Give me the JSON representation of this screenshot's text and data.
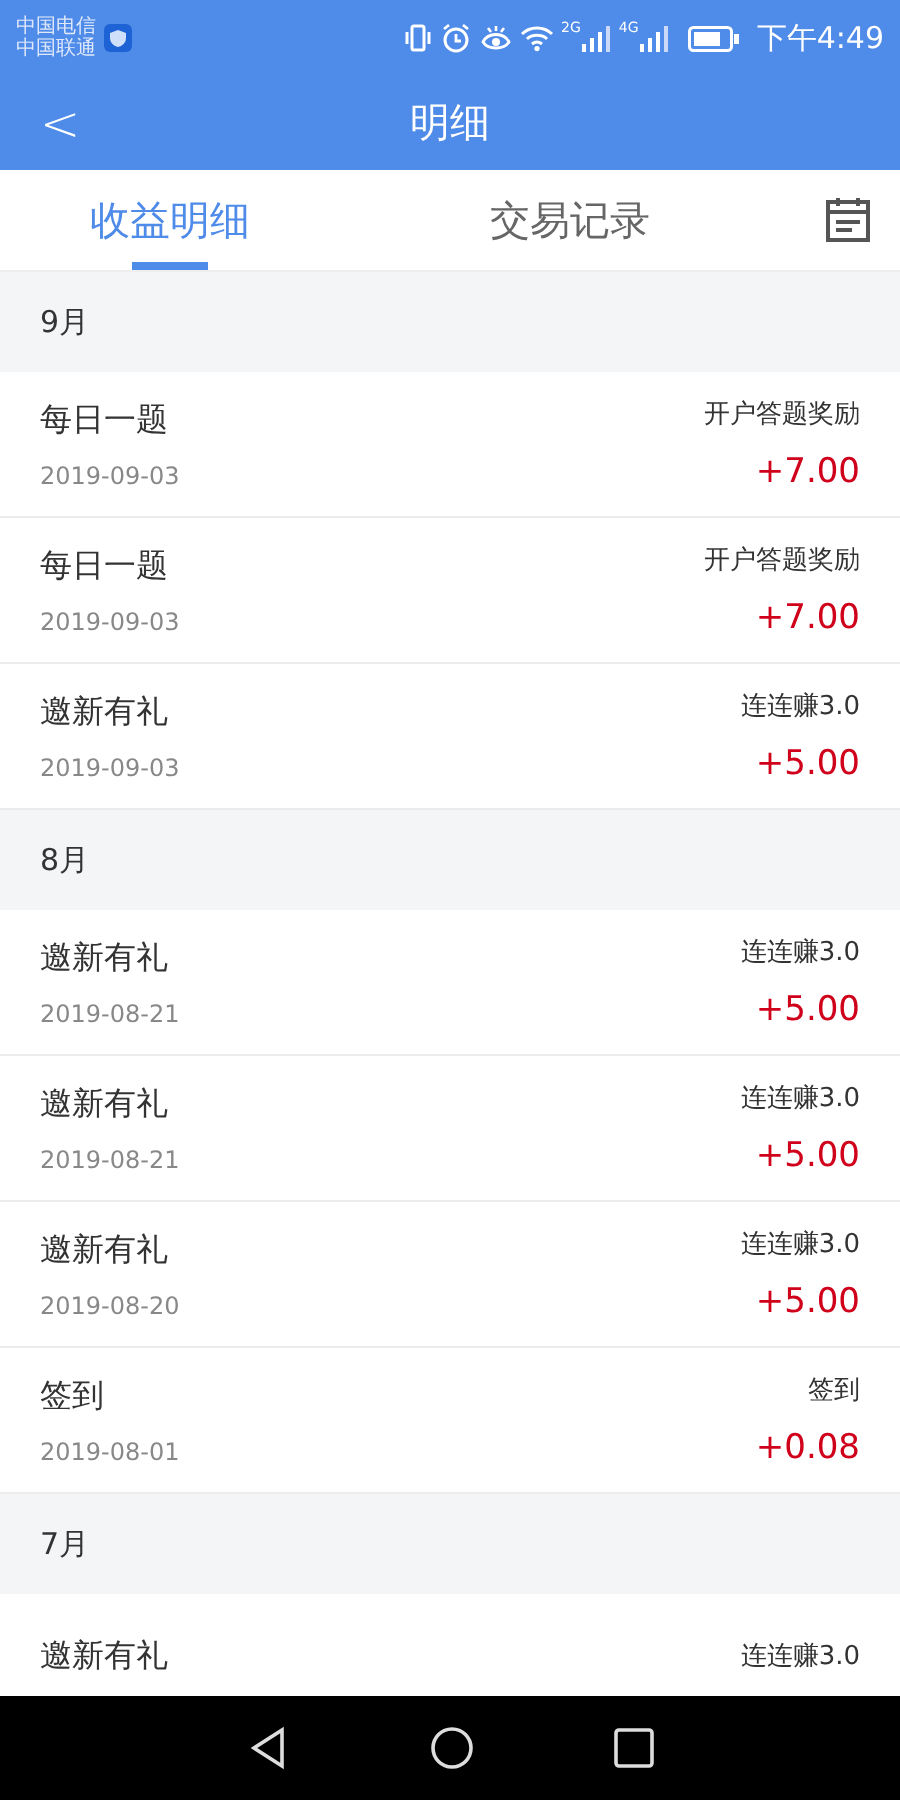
{
  "status_bar": {
    "carriers": [
      "中国电信",
      "中国联通"
    ],
    "networks": [
      "2G",
      "4G"
    ],
    "time": "下午4:49"
  },
  "header": {
    "back": "<",
    "title": "明细"
  },
  "tabs": [
    {
      "label": "收益明细",
      "selected": true
    },
    {
      "label": "交易记录",
      "selected": false
    }
  ],
  "sections": [
    {
      "month": "9月",
      "records": [
        {
          "title": "每日一题",
          "date": "2019-09-03",
          "source": "开户答题奖励",
          "amount": "+7.00"
        },
        {
          "title": "每日一题",
          "date": "2019-09-03",
          "source": "开户答题奖励",
          "amount": "+7.00"
        },
        {
          "title": "邀新有礼",
          "date": "2019-09-03",
          "source": "连连赚3.0",
          "amount": "+5.00"
        }
      ]
    },
    {
      "month": "8月",
      "records": [
        {
          "title": "邀新有礼",
          "date": "2019-08-21",
          "source": "连连赚3.0",
          "amount": "+5.00"
        },
        {
          "title": "邀新有礼",
          "date": "2019-08-21",
          "source": "连连赚3.0",
          "amount": "+5.00"
        },
        {
          "title": "邀新有礼",
          "date": "2019-08-20",
          "source": "连连赚3.0",
          "amount": "+5.00"
        },
        {
          "title": "签到",
          "date": "2019-08-01",
          "source": "签到",
          "amount": "+0.08"
        }
      ]
    },
    {
      "month": "7月",
      "records": [
        {
          "title": "邀新有礼",
          "source": "连连赚3.0"
        }
      ]
    }
  ]
}
